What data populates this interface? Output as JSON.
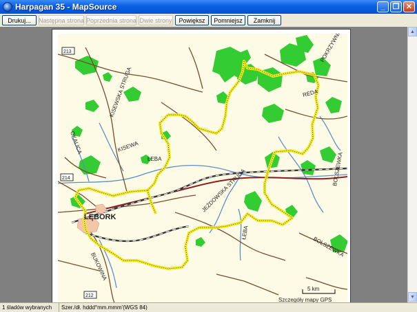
{
  "window": {
    "title": "Harpagan 35 - MapSource",
    "minimize_glyph": "_",
    "maximize_glyph": "❐",
    "close_glyph": "✕"
  },
  "toolbar": {
    "print": "Drukuj...",
    "next_page": "Następna strona",
    "prev_page": "Poprzednia strona",
    "two_pages": "Dwie strony",
    "zoom_in": "Powiększ",
    "zoom_out": "Pomniejsz",
    "close": "Zamknij"
  },
  "map": {
    "city": "LĘBORK",
    "labels": {
      "kisewska_struga": "KISEWSKA STRUGA",
      "kisewa": "KISEWA",
      "leba_river": "ŁEBA",
      "okalica": "OKALICA",
      "jezdowska_struga": "JEŻDOWSKA STRUGA",
      "reda": "REDA",
      "bolszewka": "BOLSZEWKA",
      "bolszewka_lower": "BOLSZEWKA",
      "leba_lower": "ŁEBA",
      "pokrzywnica": "POKRZYWNICA",
      "bukowina": "BUKOWINA"
    },
    "road_numbers": [
      "213",
      "214",
      "212"
    ],
    "scale_label": "5 km",
    "footer_text": "Szczegóły mapy GPS",
    "colors": {
      "background": "#fdfbe6",
      "forest": "#33cc33",
      "track": "#f2e91a",
      "river": "#5a8ec8",
      "road": "#7a4a2a",
      "rail": "#333333"
    }
  },
  "status": {
    "selected": "1 śladów wybranych",
    "coords": "Szer./dł. hddd°mm.mmm'(WGS 84)"
  }
}
